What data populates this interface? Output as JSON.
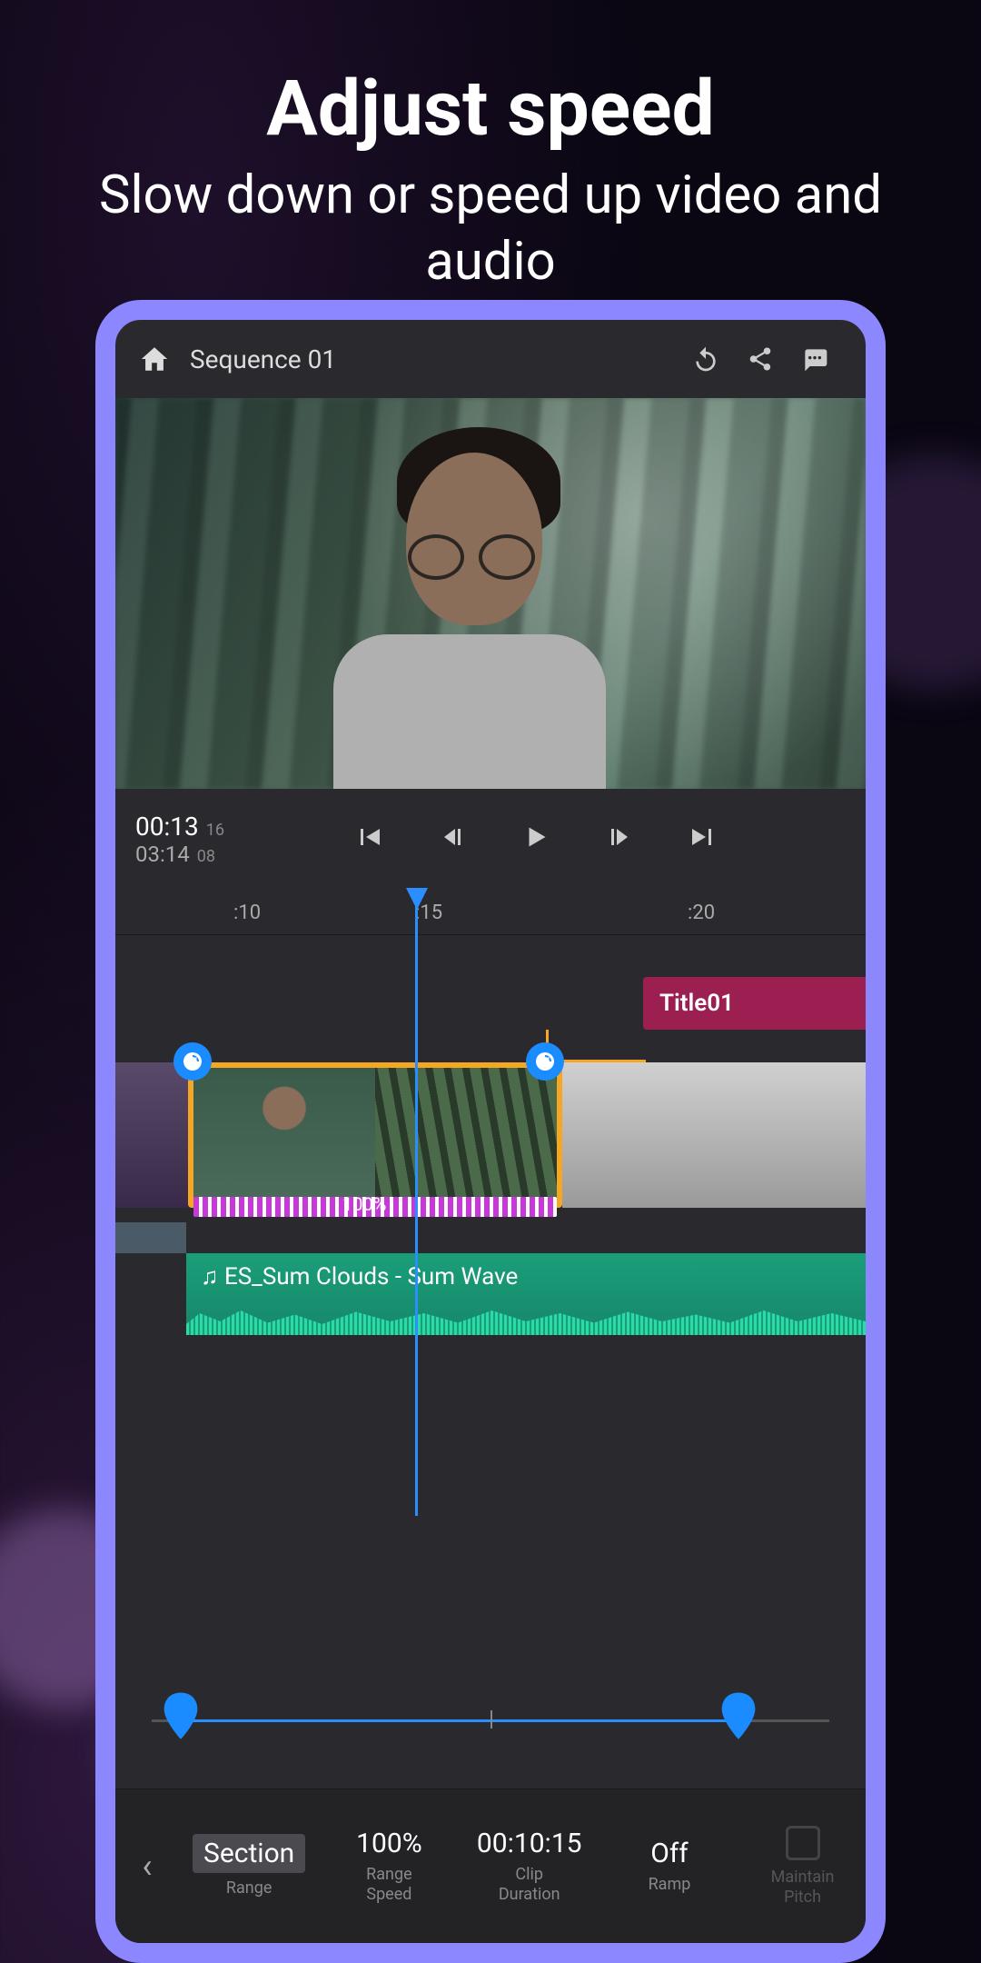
{
  "marketing": {
    "title": "Adjust speed",
    "subtitle": "Slow down or speed up video and audio"
  },
  "topbar": {
    "sequence_name": "Sequence 01"
  },
  "transport": {
    "current_time": "00:13",
    "current_frames": "16",
    "total_time": "03:14",
    "total_frames": "08"
  },
  "ruler": {
    "t1": ":10",
    "t2": ":15",
    "t3": ":20"
  },
  "timeline": {
    "title_clip": "Title01",
    "speed_overlay": "100%",
    "audio_clip": "♫ ES_Sum Clouds - Sum Wave"
  },
  "speed_panel": {
    "range_value": "Section",
    "range_label": "Range",
    "speed_value": "100%",
    "speed_label_1": "Range",
    "speed_label_2": "Speed",
    "duration_value": "00:10:15",
    "duration_label_1": "Clip",
    "duration_label_2": "Duration",
    "ramp_value": "Off",
    "ramp_label": "Ramp",
    "pitch_label_1": "Maintain",
    "pitch_label_2": "Pitch"
  }
}
